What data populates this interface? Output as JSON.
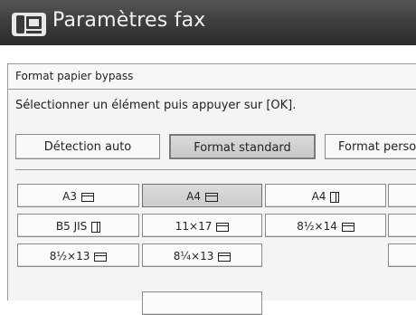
{
  "header": {
    "title": "Paramètres fax",
    "icon": "fax-icon"
  },
  "subheader": {
    "label": "Format papier bypass"
  },
  "instruction": "Sélectionner un élément puis appuyer sur [OK].",
  "tabs": [
    {
      "label": "Détection auto",
      "selected": false
    },
    {
      "label": "Format standard",
      "selected": true
    },
    {
      "label": "Format perso",
      "selected": false
    }
  ],
  "paper_sizes": [
    {
      "label": "A3",
      "orientation": "landscape",
      "selected": false
    },
    {
      "label": "A4",
      "orientation": "landscape",
      "selected": true
    },
    {
      "label": "A4",
      "orientation": "portrait",
      "selected": false
    },
    {
      "label": "",
      "orientation": "",
      "selected": false
    },
    {
      "label": "B5 JIS",
      "orientation": "portrait",
      "selected": false
    },
    {
      "label": "11×17",
      "orientation": "landscape",
      "selected": false
    },
    {
      "label": "8½×14",
      "orientation": "landscape",
      "selected": false
    },
    {
      "label": "",
      "orientation": "",
      "selected": false
    },
    {
      "label": "8½×13",
      "orientation": "landscape",
      "selected": false
    },
    {
      "label": "8¼×13",
      "orientation": "landscape",
      "selected": false
    },
    {
      "label": "",
      "orientation": "",
      "selected": false
    }
  ],
  "colors": {
    "titlebar": "#3a3a3a",
    "title_text": "#f2f2f2",
    "selected_button": "#cccccc"
  }
}
